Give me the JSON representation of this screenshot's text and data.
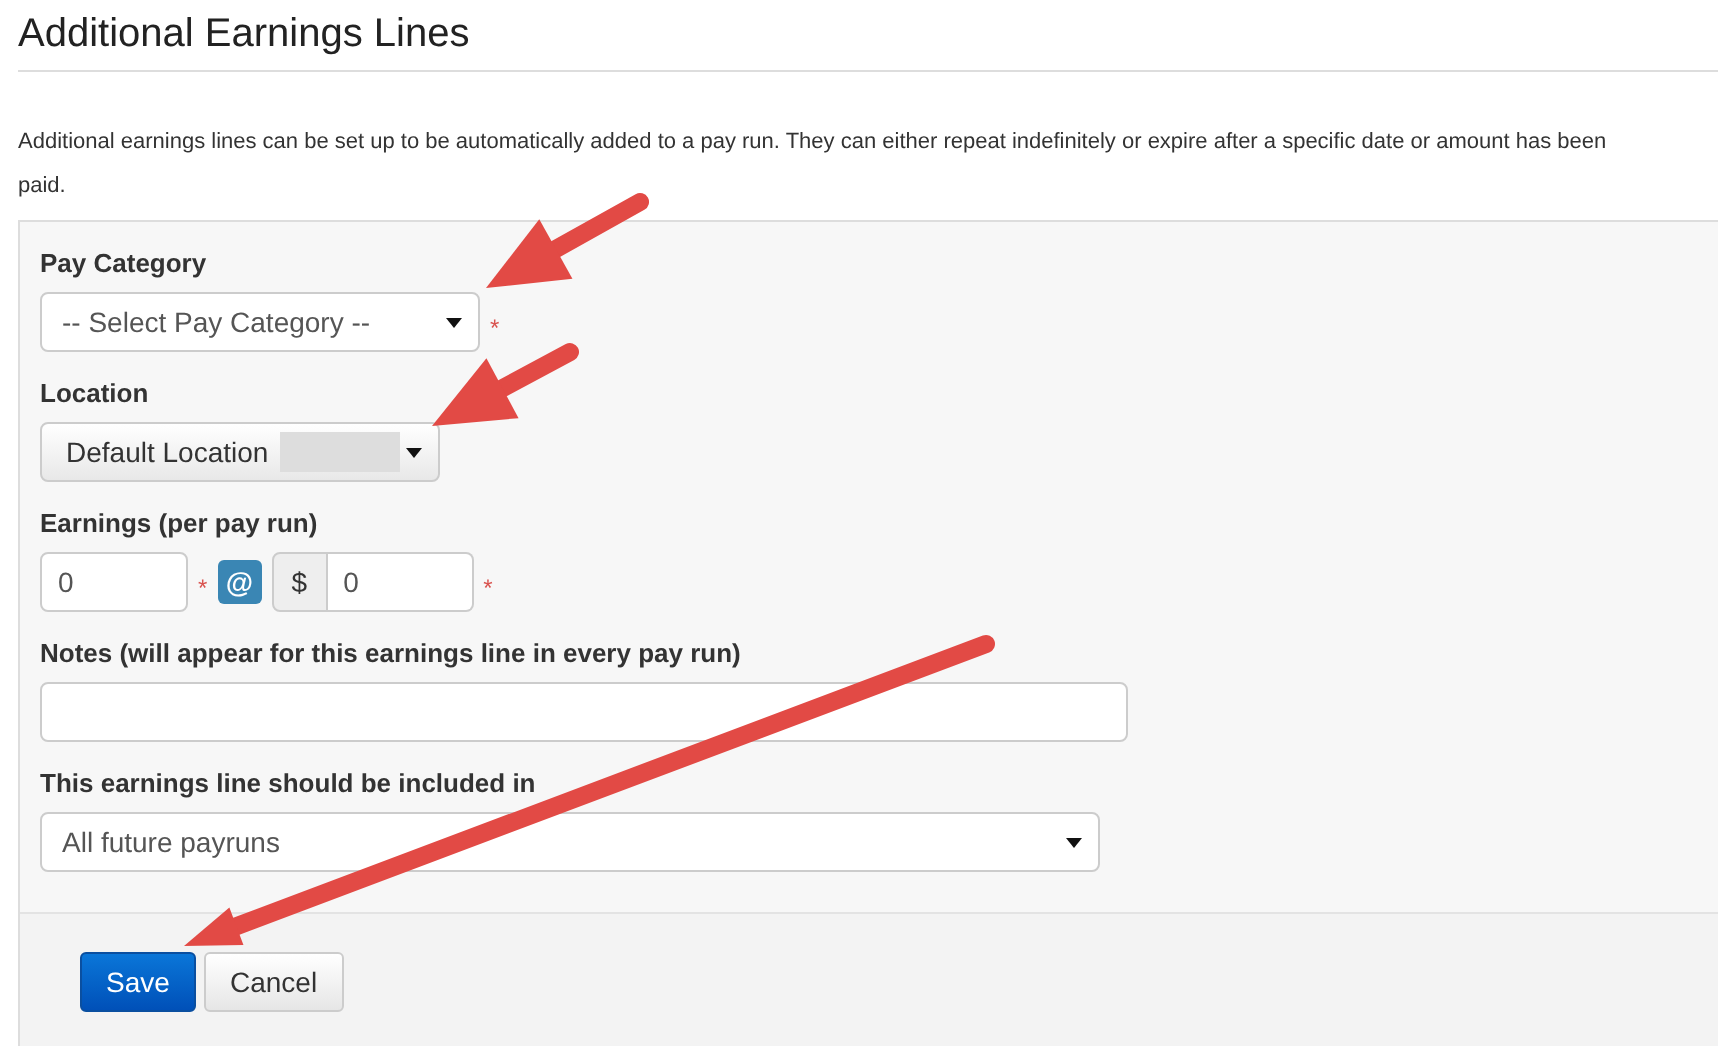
{
  "page": {
    "title": "Additional Earnings Lines",
    "description": "Additional earnings lines can be set up to be automatically added to a pay run. They can either repeat indefinitely or expire after a specific date or amount has been paid."
  },
  "form": {
    "pay_category": {
      "label": "Pay Category",
      "value": "-- Select Pay Category --",
      "required_mark": "*"
    },
    "location": {
      "label": "Location",
      "value": "Default Location"
    },
    "earnings": {
      "label": "Earnings (per pay run)",
      "quantity": "0",
      "quantity_required_mark": "*",
      "at": "@",
      "currency": "$",
      "rate": "0",
      "rate_required_mark": "*"
    },
    "notes": {
      "label": "Notes (will appear for this earnings line in every pay run)"
    },
    "included_in": {
      "label": "This earnings line should be included in",
      "value": "All future payruns"
    }
  },
  "buttons": [
    {
      "label": "Save",
      "kind": "primary"
    },
    {
      "label": "Cancel",
      "kind": "default"
    }
  ]
}
